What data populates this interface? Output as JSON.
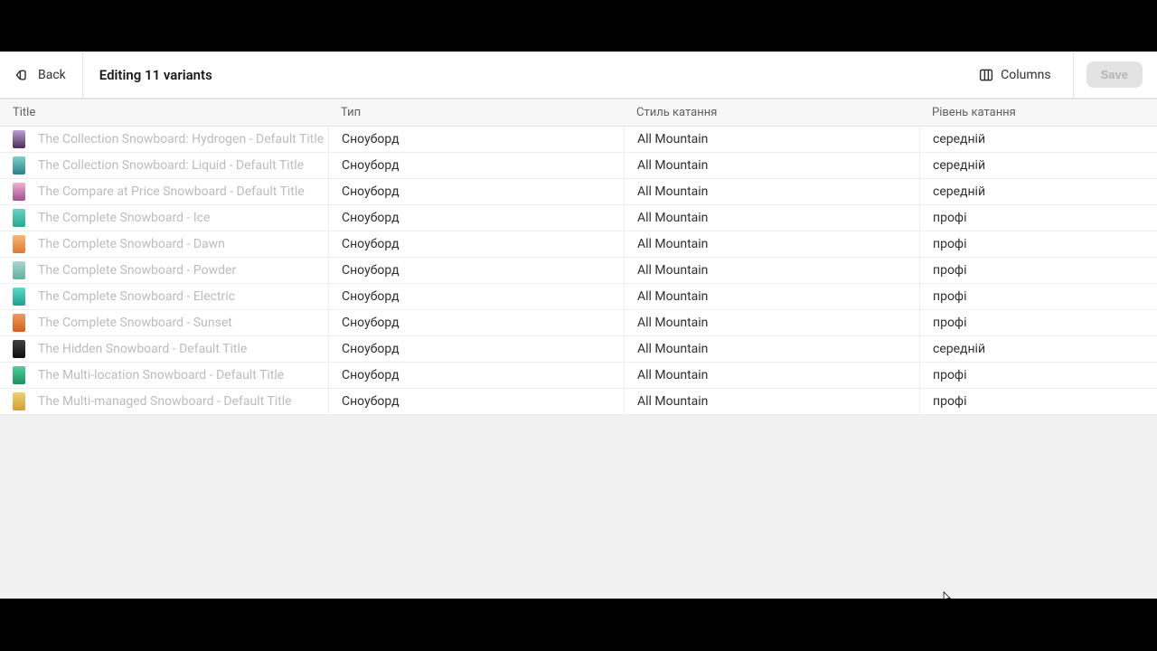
{
  "topbar": {
    "back_label": "Back",
    "title": "Editing 11 variants",
    "columns_label": "Columns",
    "save_label": "Save"
  },
  "columns": {
    "title": "Title",
    "type": "Тип",
    "style": "Стиль катання",
    "level": "Рівень катання"
  },
  "rows": [
    {
      "thumb": "linear-gradient(#bfa0d6,#4a2d5a)",
      "title": "The Collection Snowboard: Hydrogen - Default Title",
      "type": "Сноуборд",
      "style": "All Mountain",
      "level": "середній"
    },
    {
      "thumb": "linear-gradient(#7fd1c8,#2a7f8f)",
      "title": "The Collection Snowboard: Liquid - Default Title",
      "type": "Сноуборд",
      "style": "All Mountain",
      "level": "середній"
    },
    {
      "thumb": "linear-gradient(#f0b0d0,#a05090)",
      "title": "The Compare at Price Snowboard - Default Title",
      "type": "Сноуборд",
      "style": "All Mountain",
      "level": "середній"
    },
    {
      "thumb": "linear-gradient(#66d3c0,#2fa68f)",
      "title": "The Complete Snowboard - Ice",
      "type": "Сноуборд",
      "style": "All Mountain",
      "level": "профі"
    },
    {
      "thumb": "linear-gradient(#f8b878,#e07830)",
      "title": "The Complete Snowboard - Dawn",
      "type": "Сноуборд",
      "style": "All Mountain",
      "level": "профі"
    },
    {
      "thumb": "linear-gradient(#a8d8d0,#5fb0a0)",
      "title": "The Complete Snowboard - Powder",
      "type": "Сноуборд",
      "style": "All Mountain",
      "level": "профі"
    },
    {
      "thumb": "linear-gradient(#60d8c8,#20a090)",
      "title": "The Complete Snowboard - Electric",
      "type": "Сноуборд",
      "style": "All Mountain",
      "level": "профі"
    },
    {
      "thumb": "linear-gradient(#f49858,#d06020)",
      "title": "The Complete Snowboard - Sunset",
      "type": "Сноуборд",
      "style": "All Mountain",
      "level": "профі"
    },
    {
      "thumb": "linear-gradient(#404040,#101010)",
      "title": "The Hidden Snowboard - Default Title",
      "type": "Сноуборд",
      "style": "All Mountain",
      "level": "середній"
    },
    {
      "thumb": "linear-gradient(#50d0a0,#209060)",
      "title": "The Multi-location Snowboard - Default Title",
      "type": "Сноуборд",
      "style": "All Mountain",
      "level": "профі"
    },
    {
      "thumb": "linear-gradient(#f0d070,#d0a030)",
      "title": "The Multi-managed Snowboard - Default Title",
      "type": "Сноуборд",
      "style": "All Mountain",
      "level": "профі"
    }
  ]
}
